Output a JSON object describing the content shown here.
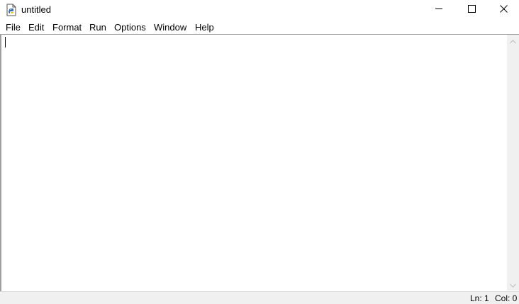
{
  "window": {
    "title": "untitled",
    "app_icon": "python-idle-file-icon",
    "controls": {
      "minimize_icon": "minimize-icon",
      "maximize_icon": "maximize-icon",
      "close_icon": "close-icon"
    }
  },
  "menubar": {
    "items": [
      {
        "label": "File"
      },
      {
        "label": "Edit"
      },
      {
        "label": "Format"
      },
      {
        "label": "Run"
      },
      {
        "label": "Options"
      },
      {
        "label": "Window"
      },
      {
        "label": "Help"
      }
    ]
  },
  "editor": {
    "content": ""
  },
  "scrollbar": {
    "up_icon": "scroll-up-arrow-icon",
    "down_icon": "scroll-down-arrow-icon"
  },
  "statusbar": {
    "line": "Ln: 1",
    "column": "Col: 0"
  },
  "colors": {
    "background": "#ffffff",
    "statusbar": "#f0f0f0",
    "border": "#a0a0a0",
    "text": "#000000"
  }
}
